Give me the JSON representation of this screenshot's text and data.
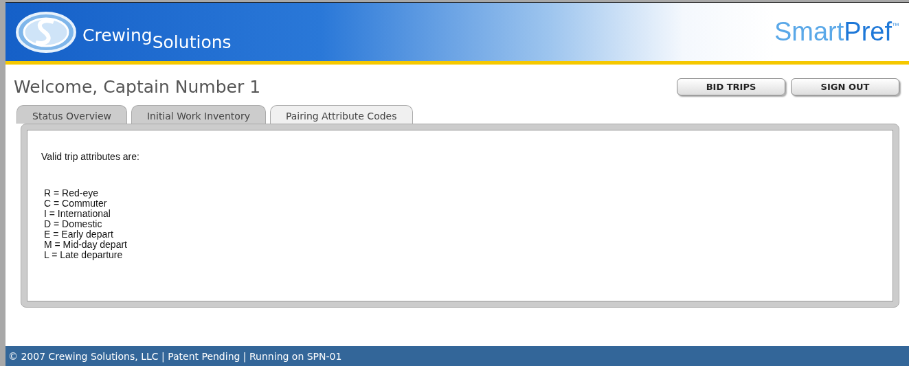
{
  "header": {
    "brand": {
      "word1": "Crewing",
      "word2": "Solutions"
    },
    "product": {
      "part1": "Smart",
      "part2": "Pref",
      "mark": "™"
    }
  },
  "welcome": "Welcome, Captain Number 1",
  "buttons": [
    "BID TRIPS",
    "SIGN OUT"
  ],
  "tabs": [
    {
      "label": "Status Overview",
      "selected": false
    },
    {
      "label": "Initial Work Inventory",
      "selected": false
    },
    {
      "label": "Pairing Attribute Codes",
      "selected": true
    }
  ],
  "panel": {
    "intro": "Valid trip attributes are:",
    "codes": [
      "R = Red-eye",
      "C = Commuter",
      "I = International",
      "D = Domestic",
      "E = Early depart",
      "M = Mid-day depart",
      "L = Late departure"
    ]
  },
  "footer": "© 2007 Crewing Solutions, LLC | Patent Pending | Running on SPN-01"
}
